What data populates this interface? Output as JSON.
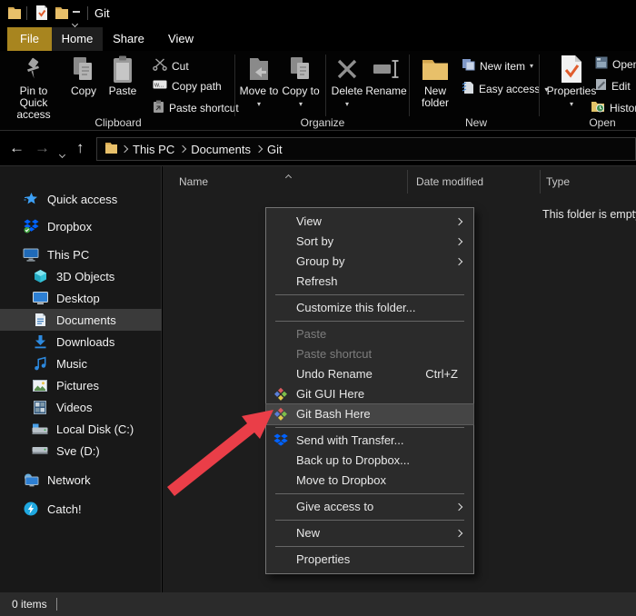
{
  "window": {
    "title": "Git"
  },
  "tabs": {
    "file": "File",
    "home": "Home",
    "share": "Share",
    "view": "View"
  },
  "ribbon": {
    "clipboard": {
      "label": "Clipboard",
      "pin": "Pin to Quick access",
      "copy": "Copy",
      "paste": "Paste",
      "cut": "Cut",
      "copy_path": "Copy path",
      "paste_shortcut": "Paste shortcut"
    },
    "organize": {
      "label": "Organize",
      "move_to": "Move to",
      "copy_to": "Copy to",
      "delete": "Delete",
      "rename": "Rename"
    },
    "new_group": {
      "label": "New",
      "new_folder": "New folder",
      "new_item": "New item",
      "easy_access": "Easy access"
    },
    "open_group": {
      "label": "Open",
      "properties": "Properties",
      "open": "Open",
      "edit": "Edit",
      "history": "History"
    }
  },
  "address": {
    "crumbs": [
      "This PC",
      "Documents",
      "Git"
    ]
  },
  "sidebar": {
    "items": [
      {
        "label": "Quick access",
        "icon": "quick-access-icon"
      },
      {
        "label": "Dropbox",
        "icon": "dropbox-icon"
      },
      {
        "label": "This PC",
        "icon": "this-pc-icon"
      },
      {
        "label": "3D Objects",
        "icon": "3d-objects-icon"
      },
      {
        "label": "Desktop",
        "icon": "desktop-icon"
      },
      {
        "label": "Documents",
        "icon": "documents-icon"
      },
      {
        "label": "Downloads",
        "icon": "downloads-icon"
      },
      {
        "label": "Music",
        "icon": "music-icon"
      },
      {
        "label": "Pictures",
        "icon": "pictures-icon"
      },
      {
        "label": "Videos",
        "icon": "videos-icon"
      },
      {
        "label": "Local Disk (C:)",
        "icon": "local-disk-icon"
      },
      {
        "label": "Sve (D:)",
        "icon": "disk-icon"
      },
      {
        "label": "Network",
        "icon": "network-icon"
      },
      {
        "label": "Catch!",
        "icon": "catch-icon"
      }
    ]
  },
  "main": {
    "columns": [
      "Name",
      "Date modified",
      "Type"
    ],
    "empty_text": "This folder is empty."
  },
  "context_menu": {
    "items": [
      {
        "label": "View",
        "submenu": true
      },
      {
        "label": "Sort by",
        "submenu": true
      },
      {
        "label": "Group by",
        "submenu": true
      },
      {
        "label": "Refresh"
      },
      {
        "label": "Customize this folder..."
      },
      {
        "label": "Paste",
        "disabled": true
      },
      {
        "label": "Paste shortcut",
        "disabled": true
      },
      {
        "label": "Undo Rename",
        "shortcut": "Ctrl+Z"
      },
      {
        "label": "Git GUI Here",
        "icon": "git-icon"
      },
      {
        "label": "Git Bash Here",
        "icon": "git-icon",
        "selected": true
      },
      {
        "label": "Send with Transfer...",
        "icon": "dropbox-icon"
      },
      {
        "label": "Back up to Dropbox..."
      },
      {
        "label": "Move to Dropbox"
      },
      {
        "label": "Give access to",
        "submenu": true
      },
      {
        "label": "New",
        "submenu": true
      },
      {
        "label": "Properties"
      }
    ]
  },
  "status_bar": {
    "items_count": "0 items"
  },
  "colors": {
    "accent_gold": "#a8851f",
    "arrow_red": "#ea3e48",
    "selection_gray": "#454545",
    "dropbox_blue": "#0062ff",
    "folder_yellow": "#e8c06a"
  }
}
